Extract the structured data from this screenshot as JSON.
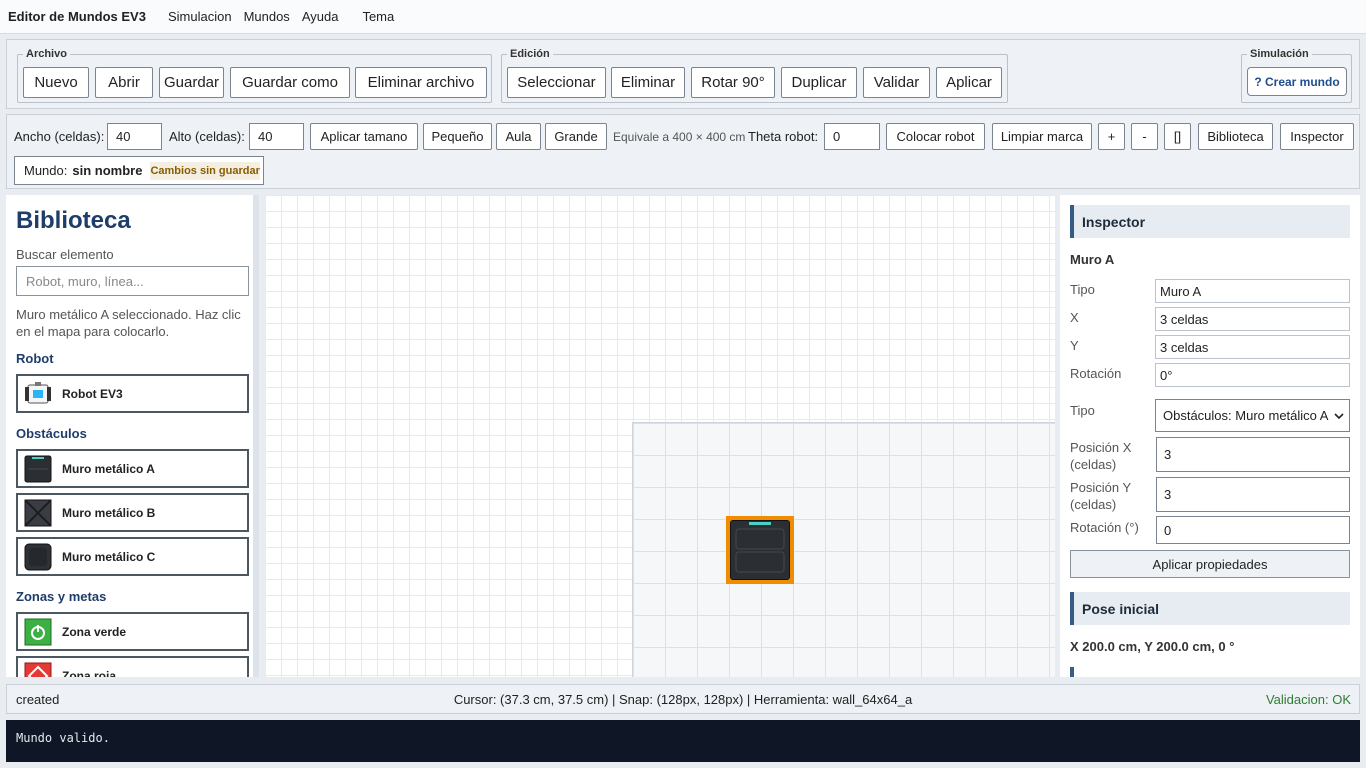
{
  "menubar": {
    "title": "Editor de Mundos EV3",
    "items": [
      "Simulacion",
      "Mundos",
      "Ayuda",
      "Tema"
    ]
  },
  "archivo": {
    "legend": "Archivo",
    "buttons": [
      "Nuevo",
      "Abrir",
      "Guardar",
      "Guardar como",
      "Eliminar archivo"
    ]
  },
  "edicion": {
    "legend": "Edición",
    "buttons": [
      "Seleccionar",
      "Eliminar",
      "Rotar 90°",
      "Duplicar",
      "Validar",
      "Aplicar"
    ]
  },
  "simulacion": {
    "legend": "Simulación",
    "crear": "? Crear mundo"
  },
  "size": {
    "ancho_label": "Ancho (celdas):",
    "ancho_value": "40",
    "alto_label": "Alto (celdas):",
    "alto_value": "40",
    "aplicar": "Aplicar tamano",
    "pequeno": "Pequeño",
    "aula": "Aula",
    "grande": "Grande",
    "equivale": "Equivale a 400 × 400 cm",
    "theta_label": "Theta robot:",
    "theta_value": "0",
    "colocar": "Colocar robot",
    "limpiar": "Limpiar marca",
    "zoom_in": "+",
    "zoom_out": "-",
    "fit": "[]",
    "biblioteca": "Biblioteca",
    "inspector": "Inspector"
  },
  "world": {
    "label": "Mundo:",
    "name": "sin nombre",
    "unsaved": "Cambios sin guardar"
  },
  "library": {
    "title": "Biblioteca",
    "search_label": "Buscar elemento",
    "search_placeholder": "Robot, muro, línea...",
    "message": "Muro metálico A seleccionado. Haz clic en el mapa para colocarlo.",
    "sections": {
      "robot": "Robot",
      "obstaculos": "Obstáculos",
      "zonas": "Zonas y metas"
    },
    "items": {
      "robot_ev3": "Robot EV3",
      "muro_a": "Muro metálico A",
      "muro_b": "Muro metálico B",
      "muro_c": "Muro metálico C",
      "zona_verde": "Zona verde",
      "zona_roja": "Zona roja"
    }
  },
  "inspector": {
    "title": "Inspector",
    "selected": "Muro A",
    "tipo_label": "Tipo",
    "tipo_value": "Muro A",
    "x_label": "X",
    "x_value": "3 celdas",
    "y_label": "Y",
    "y_value": "3 celdas",
    "rot_label": "Rotación",
    "rot_value": "0°",
    "tipo2_label": "Tipo",
    "tipo2_value": "Obstáculos: Muro metálico A",
    "posx_label": "Posición X (celdas)",
    "posx_value": "3",
    "posy_label": "Posición Y (celdas)",
    "posy_value": "3",
    "rotdeg_label": "Rotación (°)",
    "rotdeg_value": "0",
    "apply": "Aplicar propiedades",
    "pose_title": "Pose inicial",
    "pose_value": "X 200.0 cm, Y 200.0 cm, 0 °"
  },
  "status": {
    "left": "created",
    "center": "Cursor: (37.3 cm, 37.5 cm) | Snap: (128px, 128px) | Herramienta: wall_64x64_a",
    "right": "Validacion: OK"
  },
  "console": {
    "text": "Mundo valido."
  },
  "colors": {
    "accent": "#1f3d6b",
    "selection": "#f08c00",
    "valid": "#2e7d32"
  }
}
